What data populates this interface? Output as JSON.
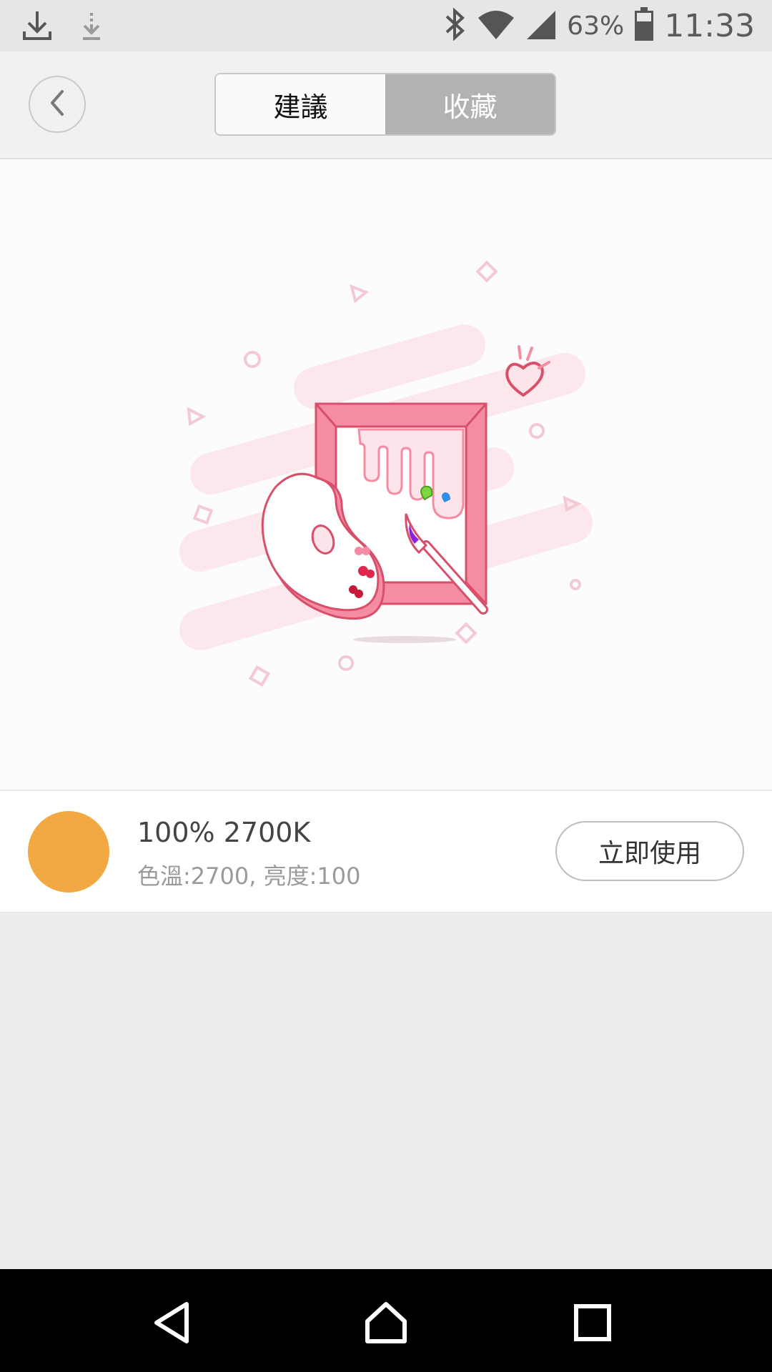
{
  "status_bar": {
    "battery_percent": "63%",
    "time": "11:33",
    "icons": [
      "download-icon",
      "download-pending-icon",
      "bluetooth-icon",
      "wifi-icon",
      "signal-icon",
      "battery-icon"
    ]
  },
  "header": {
    "back_icon": "chevron-left-icon",
    "tabs": [
      {
        "label": "建議",
        "selected": false
      },
      {
        "label": "收藏",
        "selected": true
      }
    ]
  },
  "illustration": {
    "icon": "palette-frame-illustration",
    "accent_color": "#f48ca3"
  },
  "favorite": {
    "title": "100% 2700K",
    "subtitle": "色溫:2700, 亮度:100",
    "swatch_color": "#f2a944",
    "use_button_label": "立即使用"
  },
  "nav_bar": {
    "icons": [
      "back-triangle-icon",
      "home-icon",
      "recents-icon"
    ]
  }
}
